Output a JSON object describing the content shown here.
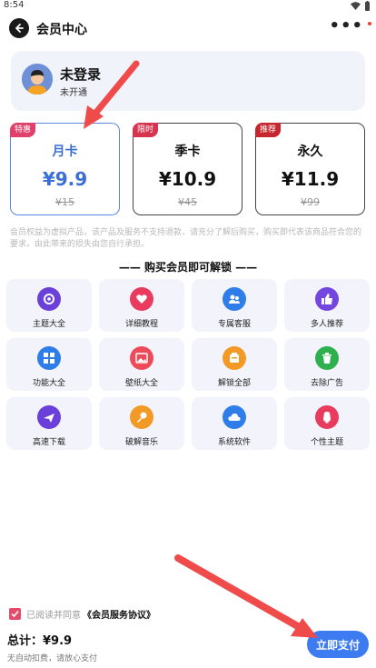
{
  "statusbar": {
    "time": "8:54"
  },
  "header": {
    "title": "会员中心",
    "more": "•••"
  },
  "profile": {
    "name": "未登录",
    "status": "未开通"
  },
  "plans": [
    {
      "tag": "特惠",
      "tag_color": "#e0406a",
      "name": "月卡",
      "price": "¥9.9",
      "original": "¥15",
      "selected": true
    },
    {
      "tag": "限时",
      "tag_color": "#d6344f",
      "name": "季卡",
      "price": "¥10.9",
      "original": "¥45",
      "selected": false
    },
    {
      "tag": "推荐",
      "tag_color": "#c7262f",
      "name": "永久",
      "price": "¥11.9",
      "original": "¥99",
      "selected": false
    }
  ],
  "disclaimer": "会员权益为虚拟产品，该产品及服务不支持退款，请充分了解后购买，购买即代表该商品符合您的要求，由此带来的损失由您自行承担。",
  "unlock_title": "—— 购买会员即可解锁 ——",
  "features": [
    {
      "label": "主题大全",
      "icon": "theme-icon",
      "color": "#6b3fd9"
    },
    {
      "label": "详细教程",
      "icon": "tutorial-icon",
      "color": "#e83b5e"
    },
    {
      "label": "专属客服",
      "icon": "customer-service-icon",
      "color": "#2f7de8"
    },
    {
      "label": "多人推荐",
      "icon": "thumbs-up-icon",
      "color": "#7346e0"
    },
    {
      "label": "功能大全",
      "icon": "apps-icon",
      "color": "#2f7de8"
    },
    {
      "label": "壁纸大全",
      "icon": "wallpaper-icon",
      "color": "#ee4b5a"
    },
    {
      "label": "解锁全部",
      "icon": "unlock-icon",
      "color": "#f29a25"
    },
    {
      "label": "去除广告",
      "icon": "trash-icon",
      "color": "#2fb04e"
    },
    {
      "label": "高速下载",
      "icon": "plane-icon",
      "color": "#6b3fd9"
    },
    {
      "label": "破解音乐",
      "icon": "microphone-icon",
      "color": "#f29a25"
    },
    {
      "label": "系统软件",
      "icon": "cloud-icon",
      "color": "#2f7de8"
    },
    {
      "label": "个性主题",
      "icon": "bulb-icon",
      "color": "#e83b5e"
    }
  ],
  "agreement": {
    "prefix": "已阅读并同意",
    "link": "《会员服务协议》",
    "checked": true
  },
  "footer": {
    "total": "总计：¥9.9",
    "note": "无自动扣费，请放心支付",
    "pay_label": "立即支付"
  }
}
